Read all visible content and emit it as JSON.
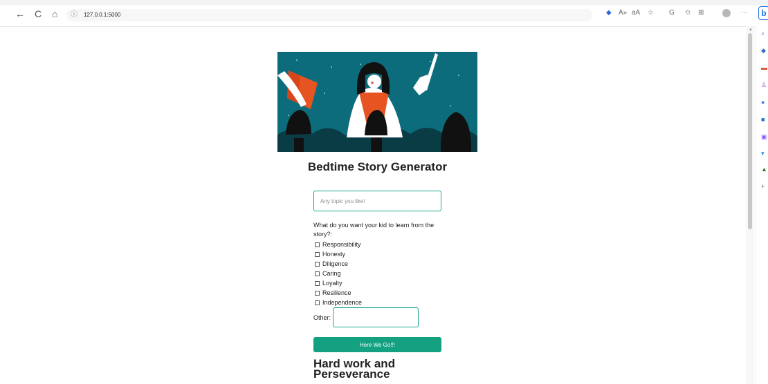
{
  "browser": {
    "url": "127.0.0.1:5000",
    "nav_back": "←",
    "nav_refresh": "C",
    "nav_home": "⌂",
    "info": "ⓘ",
    "toolbar_icons": {
      "tag": "◆",
      "read_aloud": "A»",
      "translate": "aA",
      "favorite_add": "☆",
      "app": "G",
      "favorites": "✩",
      "collections": "⊞",
      "more": "⋯",
      "bing": "b"
    },
    "sidebar_icons": [
      {
        "name": "search-icon",
        "glyph": "⌕",
        "color": "#3d6bd8"
      },
      {
        "name": "tag-icon",
        "glyph": "◆",
        "color": "#2f6ad8"
      },
      {
        "name": "briefcase-icon",
        "glyph": "▬",
        "color": "#d64f2f"
      },
      {
        "name": "people-icon",
        "glyph": "♙",
        "color": "#9f4fd1"
      },
      {
        "name": "circle-icon",
        "glyph": "●",
        "color": "#3d7be7"
      },
      {
        "name": "outlook-icon",
        "glyph": "■",
        "color": "#1976d2"
      },
      {
        "name": "image-icon",
        "glyph": "▣",
        "color": "#8b5cf6"
      },
      {
        "name": "cart-icon",
        "glyph": "▾",
        "color": "#1e88e5"
      },
      {
        "name": "tree-icon",
        "glyph": "▲",
        "color": "#2e7d32"
      },
      {
        "name": "add-icon",
        "glyph": "+",
        "color": "#666"
      }
    ]
  },
  "page": {
    "title": "Bedtime Story Generator",
    "topic_placeholder": "Any topic you like!",
    "question": "What do you want your kid to learn from the story?:",
    "options": [
      "Responsibility",
      "Honesty",
      "Diligence",
      "Caring",
      "Loyalty",
      "Resilience",
      "Independence"
    ],
    "other_label": "Other:",
    "submit_label": "Here We Go!!!",
    "result_title": "Hard work and Perseverance"
  },
  "colors": {
    "accent": "#13a181",
    "hero_bg": "#0c6c7c",
    "book_orange": "#e65521"
  }
}
